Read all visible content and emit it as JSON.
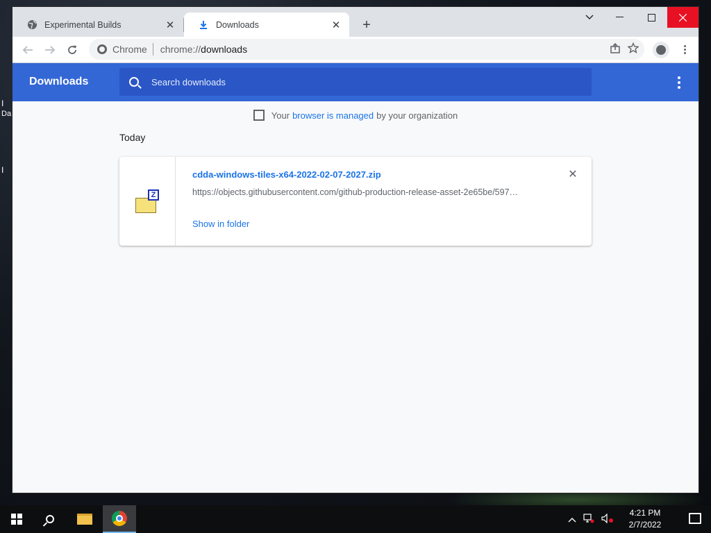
{
  "browser": {
    "tabs": [
      {
        "title": "Experimental Builds",
        "close": "✕"
      },
      {
        "title": "Downloads",
        "close": "✕"
      }
    ],
    "new_tab": "+",
    "omnibox": {
      "chip": "Chrome",
      "url_prefix": "chrome://",
      "url_host": "downloads"
    }
  },
  "downloads": {
    "title": "Downloads",
    "search_placeholder": "Search downloads",
    "managed_prefix": "Your",
    "managed_link": "browser is managed",
    "managed_suffix": "by your organization",
    "section": "Today",
    "items": [
      {
        "name": "cdda-windows-tiles-x64-2022-02-07-2027.zip",
        "url": "https://objects.githubusercontent.com/github-production-release-asset-2e65be/597…",
        "action": "Show in folder",
        "remove": "✕"
      }
    ]
  },
  "taskbar": {
    "time": "4:21 PM",
    "date": "2/7/2022"
  }
}
